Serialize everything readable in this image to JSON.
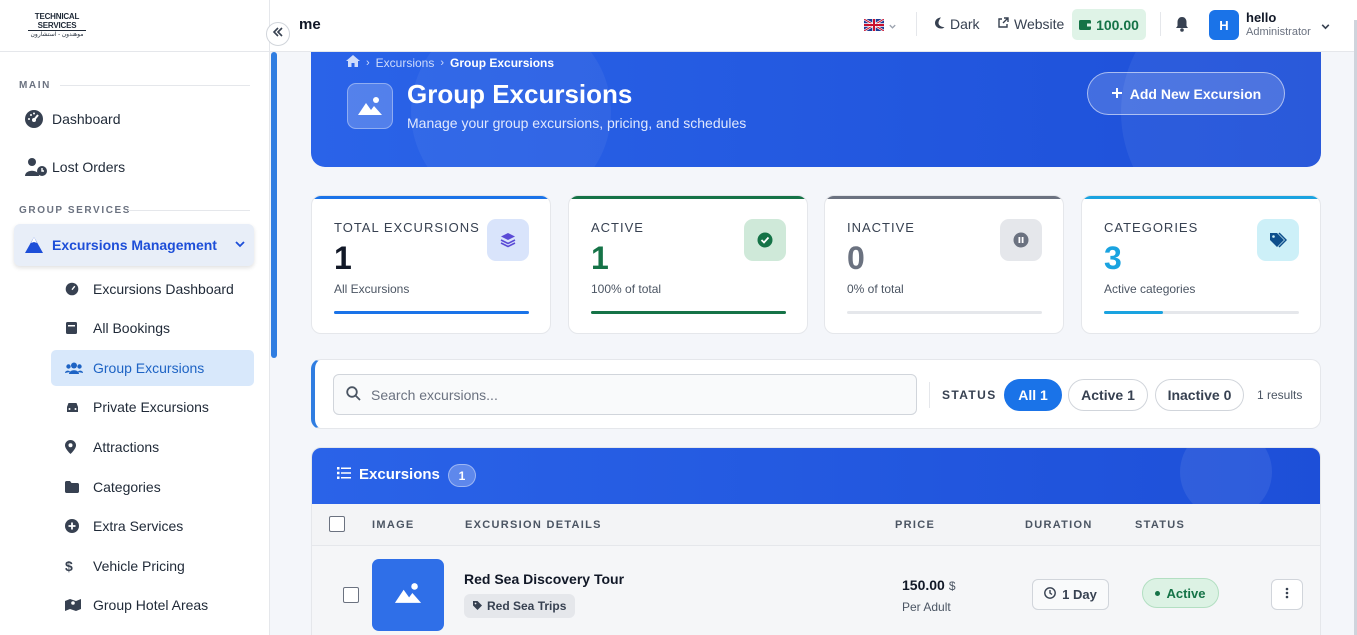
{
  "topbar": {
    "title": "me",
    "theme_label": "Dark",
    "website_label": "Website",
    "wallet_balance": "100.00",
    "user_initial": "H",
    "user_name": "hello",
    "user_role": "Administrator"
  },
  "sidebar": {
    "logo_line1": "TECHNICAL SERVICES",
    "logo_line2": "موهندون - استشارون",
    "section_main": "MAIN",
    "section_group": "GROUP SERVICES",
    "main_items": [
      {
        "label": "Dashboard",
        "icon": "gauge-icon"
      },
      {
        "label": "Lost Orders",
        "icon": "user-clock-icon"
      }
    ],
    "group_item": {
      "label": "Excursions Management",
      "icon": "mountain-icon"
    },
    "sub_items": [
      {
        "label": "Excursions Dashboard",
        "icon": "gauge-icon"
      },
      {
        "label": "All Bookings",
        "icon": "book-icon"
      },
      {
        "label": "Group Excursions",
        "icon": "users-icon",
        "active": true
      },
      {
        "label": "Private Excursions",
        "icon": "car-icon"
      },
      {
        "label": "Attractions",
        "icon": "map-pin-icon"
      },
      {
        "label": "Categories",
        "icon": "folder-icon"
      },
      {
        "label": "Extra Services",
        "icon": "plus-circle-icon"
      },
      {
        "label": "Vehicle Pricing",
        "icon": "dollar-icon"
      },
      {
        "label": "Group Hotel Areas",
        "icon": "map-icon"
      }
    ]
  },
  "hero": {
    "breadcrumb": [
      "Excursions",
      "Group Excursions"
    ],
    "title": "Group Excursions",
    "subtitle": "Manage your group excursions, pricing, and schedules",
    "add_button": "Add New Excursion"
  },
  "stats": [
    {
      "label": "TOTAL EXCURSIONS",
      "value": "1",
      "caption": "All Excursions",
      "color": "#1a73e8",
      "fill": 1.0
    },
    {
      "label": "ACTIVE",
      "value": "1",
      "caption": "100% of total",
      "color": "#157347",
      "fill": 1.0
    },
    {
      "label": "INACTIVE",
      "value": "0",
      "caption": "0% of total",
      "color": "#6b7280",
      "fill": 0.0
    },
    {
      "label": "CATEGORIES",
      "value": "3",
      "caption": "Active categories",
      "color": "#1aa3e0",
      "fill": 0.3
    }
  ],
  "filter": {
    "search_placeholder": "Search excursions...",
    "status_label": "STATUS",
    "pills": [
      {
        "label": "All",
        "count": "1",
        "active": true
      },
      {
        "label": "Active",
        "count": "1",
        "active": false
      },
      {
        "label": "Inactive",
        "count": "0",
        "active": false
      }
    ],
    "results": "1 results"
  },
  "table": {
    "title": "Excursions",
    "count": "1",
    "columns": [
      "IMAGE",
      "EXCURSION DETAILS",
      "PRICE",
      "DURATION",
      "STATUS"
    ],
    "rows": [
      {
        "name": "Red Sea Discovery Tour",
        "category": "Red Sea Trips",
        "price": "150.00",
        "currency": "$",
        "price_unit": "Per Adult",
        "duration": "1 Day",
        "status": "Active"
      }
    ]
  }
}
